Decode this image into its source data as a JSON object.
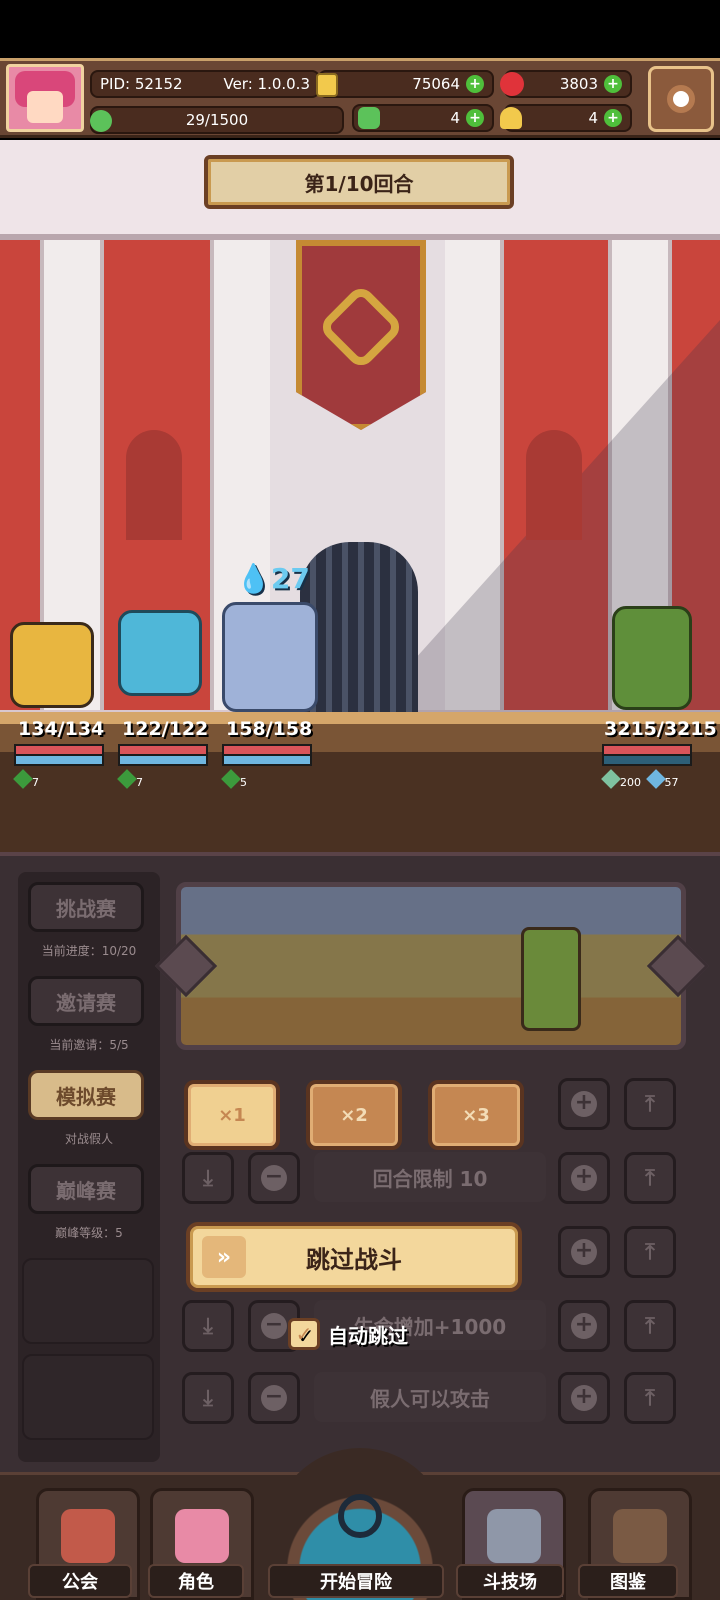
{
  "header": {
    "pid_label": "PID: 52152",
    "version_label": "Ver: 1.0.0.3",
    "gold": "75064",
    "gems": "3803",
    "exp": "29/1500",
    "clover_count": "4",
    "key_count": "4"
  },
  "battle": {
    "round_title": "第1/10回合",
    "damage_popup": "27",
    "heroes": [
      {
        "hp": "134/134",
        "buff": "7"
      },
      {
        "hp": "122/122",
        "buff": "7"
      },
      {
        "hp": "158/158",
        "buff": "5"
      }
    ],
    "enemy": {
      "hp": "3215/3215",
      "buff_a": "200",
      "buff_b": "57"
    }
  },
  "modes": [
    {
      "label": "挑战赛",
      "sub": "当前进度：10/20",
      "active": false
    },
    {
      "label": "邀请赛",
      "sub": "当前邀请：5/5",
      "active": false
    },
    {
      "label": "模拟赛",
      "sub": "对战假人",
      "active": true
    },
    {
      "label": "巅峰赛",
      "sub": "巅峰等级：5",
      "active": false
    }
  ],
  "speed": [
    "×1",
    "×2",
    "×3"
  ],
  "rules": {
    "round_limit": "回合限制 10",
    "hp_bonus": "生命增加+1000",
    "dummy_attack": "假人可以攻击"
  },
  "skip_button": "跳过战斗",
  "auto_skip_label": "自动跳过",
  "nav": {
    "guild": "公会",
    "role": "角色",
    "adventure": "开始冒险",
    "arena": "斗技场",
    "codex": "图鉴"
  },
  "colors": {
    "accent_gold": "#f3d79c",
    "hp_red": "#d9545a",
    "mana_blue": "#6fb6e0"
  }
}
